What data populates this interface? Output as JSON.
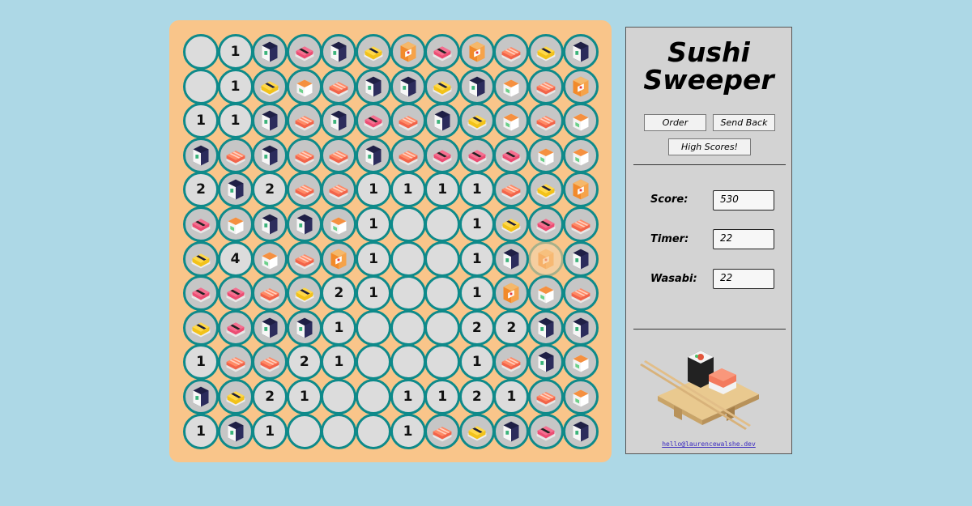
{
  "game": {
    "title_line1": "Sushi",
    "title_line2": "Sweeper",
    "buttons": {
      "order": "Order",
      "send_back": "Send Back",
      "high_scores": "High Scores!"
    },
    "stats": [
      {
        "label": "Score:",
        "value": "530"
      },
      {
        "label": "Timer:",
        "value": "22"
      },
      {
        "label": "Wasabi:",
        "value": "22"
      }
    ],
    "email": "hello@laurencewalshe.dev",
    "colors": {
      "page_bg": "#add8e6",
      "board_bg": "#f9c58a",
      "ring": "#0e8a8a",
      "panel_bg": "#d3d3d3"
    },
    "legend_cell_codes": {
      "E": "revealed empty",
      "1-8": "revealed number",
      "M": "maki (dark roll) hidden tile",
      "T": "tuna nigiri hidden tile",
      "S": "salmon nigiri hidden tile",
      "Y": "tamago nigiri hidden tile",
      "P": "salmon roll hidden tile",
      "N": "salmon maki hidden tile",
      "H": "hovered hidden tile"
    }
  },
  "board": [
    [
      "E",
      "1",
      "M",
      "T",
      "M",
      "Y",
      "P",
      "T",
      "P",
      "S",
      "Y",
      "M"
    ],
    [
      "E",
      "1",
      "Y",
      "N",
      "S",
      "M",
      "M",
      "Y",
      "M",
      "N",
      "S",
      "P"
    ],
    [
      "1",
      "1",
      "M",
      "S",
      "M",
      "T",
      "S",
      "M",
      "Y",
      "N",
      "S",
      "N"
    ],
    [
      "M",
      "S",
      "M",
      "S",
      "S",
      "M",
      "S",
      "T",
      "T",
      "T",
      "N",
      "N"
    ],
    [
      "2",
      "M",
      "2",
      "S",
      "S",
      "1",
      "1",
      "1",
      "1",
      "S",
      "Y",
      "P"
    ],
    [
      "T",
      "N",
      "M",
      "M",
      "N",
      "1",
      "E",
      "E",
      "1",
      "Y",
      "T",
      "S"
    ],
    [
      "Y",
      "4",
      "N",
      "S",
      "P",
      "1",
      "E",
      "E",
      "1",
      "M",
      "H",
      "M"
    ],
    [
      "T",
      "T",
      "S",
      "Y",
      "2",
      "1",
      "E",
      "E",
      "1",
      "P",
      "N",
      "S"
    ],
    [
      "Y",
      "T",
      "M",
      "M",
      "1",
      "E",
      "E",
      "E",
      "2",
      "2",
      "M",
      "M"
    ],
    [
      "1",
      "S",
      "S",
      "2",
      "1",
      "E",
      "E",
      "E",
      "1",
      "S",
      "M",
      "N"
    ],
    [
      "M",
      "Y",
      "2",
      "1",
      "E",
      "E",
      "1",
      "1",
      "2",
      "1",
      "S",
      "N"
    ],
    [
      "1",
      "M",
      "1",
      "E",
      "E",
      "E",
      "1",
      "S",
      "Y",
      "M",
      "T",
      "M"
    ]
  ]
}
